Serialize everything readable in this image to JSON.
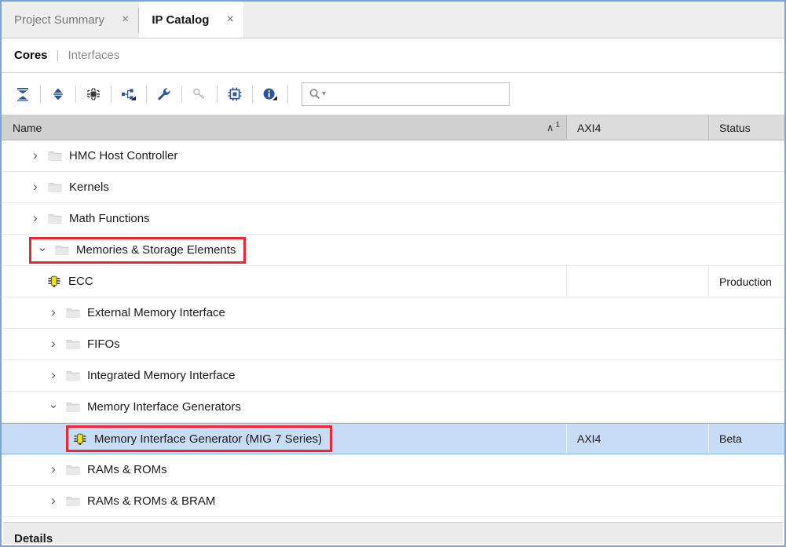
{
  "window": {
    "border_color": "#7aa5d2"
  },
  "tabs": [
    {
      "label": "Project Summary",
      "active": false,
      "close_glyph": "×"
    },
    {
      "label": "IP Catalog",
      "active": true,
      "close_glyph": "×"
    }
  ],
  "subtabs": {
    "cores_label": "Cores",
    "separator": "|",
    "interfaces_label": "Interfaces"
  },
  "toolbar": {
    "icons": [
      {
        "name": "collapse-all-icon",
        "title": "Collapse All"
      },
      {
        "name": "expand-all-icon",
        "title": "Expand All"
      },
      {
        "name": "ip-settings-icon",
        "title": "IP Settings"
      },
      {
        "name": "group-hierarchy-icon",
        "title": "Group By"
      },
      {
        "name": "wrench-icon",
        "title": "Customize IP"
      },
      {
        "name": "key-icon",
        "title": "Licenses"
      },
      {
        "name": "chip-icon",
        "title": "IP Properties"
      },
      {
        "name": "info-icon",
        "title": "Information"
      }
    ]
  },
  "search": {
    "value": "",
    "placeholder": "",
    "icon": "search-icon",
    "dropdown_glyph": "▾"
  },
  "columns": {
    "name": {
      "label": "Name",
      "sort_caret": "∧",
      "sort_order": "1"
    },
    "axi4": {
      "label": "AXI4"
    },
    "status": {
      "label": "Status"
    }
  },
  "rows": [
    {
      "level": 1,
      "expander": "collapsed",
      "icon": "folder-icon",
      "label": "HMC Host Controller",
      "axi4": "",
      "status": "",
      "selected": false,
      "highlighted": false
    },
    {
      "level": 1,
      "expander": "collapsed",
      "icon": "folder-icon",
      "label": "Kernels",
      "axi4": "",
      "status": "",
      "selected": false,
      "highlighted": false
    },
    {
      "level": 1,
      "expander": "collapsed",
      "icon": "folder-icon",
      "label": "Math Functions",
      "axi4": "",
      "status": "",
      "selected": false,
      "highlighted": false
    },
    {
      "level": 1,
      "expander": "expanded",
      "icon": "folder-icon",
      "label": "Memories & Storage Elements",
      "axi4": "",
      "status": "",
      "selected": false,
      "highlighted": true
    },
    {
      "level": 2,
      "expander": "none",
      "icon": "ip-core-icon",
      "label": "ECC",
      "axi4": "",
      "status": "Production",
      "selected": false,
      "highlighted": false
    },
    {
      "level": 2,
      "expander": "collapsed",
      "icon": "folder-icon",
      "label": "External Memory Interface",
      "axi4": "",
      "status": "",
      "selected": false,
      "highlighted": false
    },
    {
      "level": 2,
      "expander": "collapsed",
      "icon": "folder-icon",
      "label": "FIFOs",
      "axi4": "",
      "status": "",
      "selected": false,
      "highlighted": false
    },
    {
      "level": 2,
      "expander": "collapsed",
      "icon": "folder-icon",
      "label": "Integrated Memory Interface",
      "axi4": "",
      "status": "",
      "selected": false,
      "highlighted": false
    },
    {
      "level": 2,
      "expander": "expanded",
      "icon": "folder-icon",
      "label": "Memory Interface Generators",
      "axi4": "",
      "status": "",
      "selected": false,
      "highlighted": false
    },
    {
      "level": 3,
      "expander": "none",
      "icon": "ip-core-icon",
      "label": "Memory Interface Generator (MIG 7 Series)",
      "axi4": "AXI4",
      "status": "Beta",
      "selected": true,
      "highlighted": true
    },
    {
      "level": 2,
      "expander": "collapsed",
      "icon": "folder-icon",
      "label": "RAMs & ROMs",
      "axi4": "",
      "status": "",
      "selected": false,
      "highlighted": false
    },
    {
      "level": 2,
      "expander": "collapsed",
      "icon": "folder-icon",
      "label": "RAMs & ROMs & BRAM",
      "axi4": "",
      "status": "",
      "selected": false,
      "highlighted": false
    }
  ],
  "details": {
    "label": "Details"
  },
  "glyphs": {
    "chevron_collapsed": "›",
    "chevron_expanded": "⌄"
  },
  "colors": {
    "selection": "#c8dcf5",
    "highlight_box": "#f5232b",
    "header_bg": "#d4d4d4",
    "ip_icon_yellow": "#f2e21a",
    "toolbar_icon": "#2a5699"
  }
}
